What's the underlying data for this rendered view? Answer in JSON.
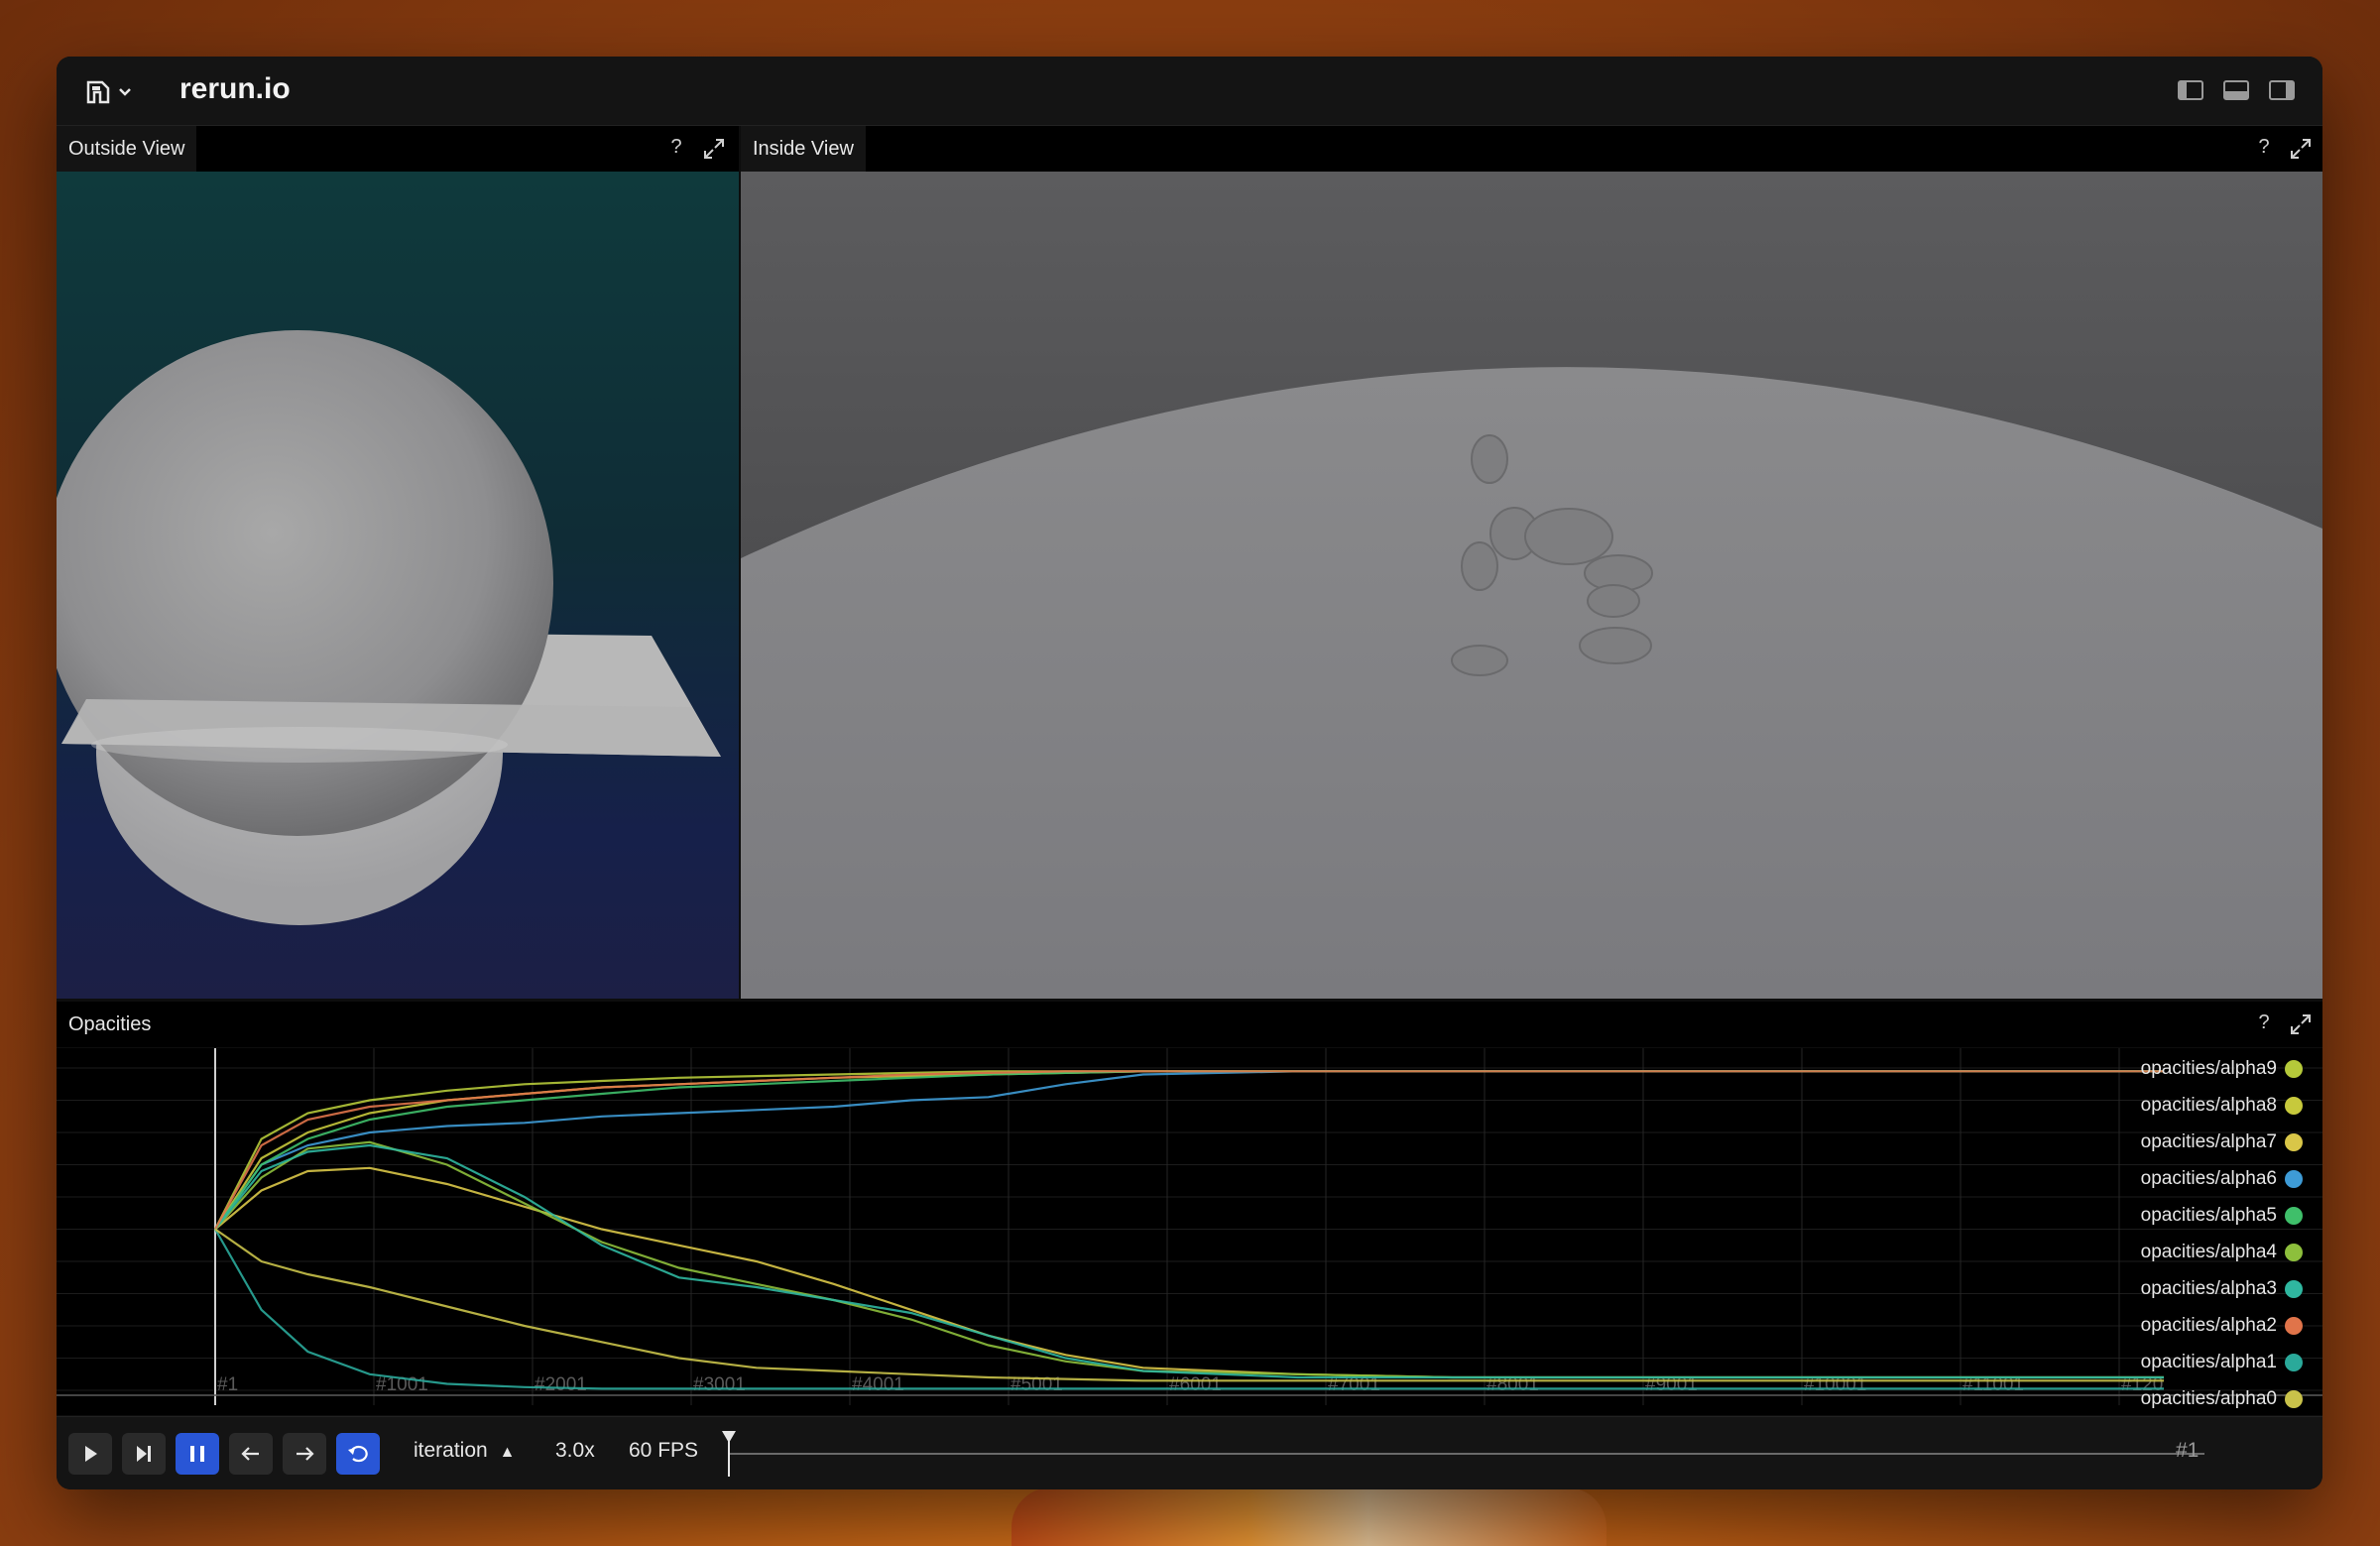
{
  "app": {
    "title": "rerun.io"
  },
  "panels": {
    "outside": {
      "title": "Outside View",
      "help": "?"
    },
    "inside": {
      "title": "Inside View",
      "help": "?"
    },
    "opacities": {
      "title": "Opacities",
      "help": "?"
    }
  },
  "timeline": {
    "timeline_name": "iteration",
    "speed": "3.0x",
    "fps": "60 FPS",
    "current": "#1",
    "accent_color": "#2956d6"
  },
  "chart_data": {
    "type": "line",
    "x_tick_labels": [
      "#1",
      "#1001",
      "#2001",
      "#3001",
      "#4001",
      "#5001",
      "#6001",
      "#7001",
      "#8001",
      "#9001",
      "#10001",
      "#11001",
      "#120"
    ],
    "xlim": [
      1,
      12600
    ],
    "ylim": [
      0,
      1
    ],
    "grid": true,
    "legend_placement": "right",
    "x": [
      1,
      300,
      600,
      1000,
      1500,
      2000,
      2500,
      3000,
      3500,
      4000,
      4500,
      5000,
      5500,
      6000,
      7000,
      8000,
      9000,
      10000,
      12600
    ],
    "series": [
      {
        "name": "opacities/alpha9",
        "color": "#b5c93a",
        "values": [
          0.5,
          0.78,
          0.86,
          0.9,
          0.93,
          0.95,
          0.96,
          0.97,
          0.975,
          0.98,
          0.985,
          0.99,
          0.99,
          0.99,
          0.99,
          0.99,
          0.99,
          0.99,
          0.99
        ]
      },
      {
        "name": "opacities/alpha8",
        "color": "#c7c93c",
        "values": [
          0.5,
          0.72,
          0.8,
          0.86,
          0.9,
          0.92,
          0.94,
          0.95,
          0.96,
          0.97,
          0.975,
          0.98,
          0.985,
          0.99,
          0.99,
          0.99,
          0.99,
          0.99,
          0.99
        ]
      },
      {
        "name": "opacities/alpha7",
        "color": "#d9c648",
        "values": [
          0.5,
          0.62,
          0.68,
          0.69,
          0.64,
          0.57,
          0.5,
          0.45,
          0.4,
          0.33,
          0.25,
          0.17,
          0.11,
          0.07,
          0.05,
          0.04,
          0.04,
          0.04,
          0.04
        ]
      },
      {
        "name": "opacities/alpha6",
        "color": "#3e9bd6",
        "values": [
          0.5,
          0.7,
          0.76,
          0.8,
          0.82,
          0.83,
          0.85,
          0.86,
          0.87,
          0.88,
          0.9,
          0.91,
          0.95,
          0.98,
          0.99,
          0.99,
          0.99,
          0.99,
          0.99
        ]
      },
      {
        "name": "opacities/alpha5",
        "color": "#3fbf6a",
        "values": [
          0.5,
          0.7,
          0.78,
          0.84,
          0.88,
          0.9,
          0.92,
          0.94,
          0.95,
          0.96,
          0.97,
          0.98,
          0.985,
          0.99,
          0.99,
          0.99,
          0.99,
          0.99,
          0.99
        ]
      },
      {
        "name": "opacities/alpha4",
        "color": "#8dbf3c",
        "values": [
          0.5,
          0.66,
          0.75,
          0.77,
          0.7,
          0.58,
          0.46,
          0.38,
          0.33,
          0.28,
          0.22,
          0.14,
          0.09,
          0.06,
          0.05,
          0.04,
          0.04,
          0.04,
          0.04
        ]
      },
      {
        "name": "opacities/alpha3",
        "color": "#2fb7a0",
        "values": [
          0.5,
          0.68,
          0.74,
          0.76,
          0.72,
          0.6,
          0.45,
          0.35,
          0.32,
          0.28,
          0.24,
          0.17,
          0.1,
          0.06,
          0.04,
          0.04,
          0.04,
          0.04,
          0.04
        ]
      },
      {
        "name": "opacities/alpha2",
        "color": "#e0744a",
        "values": [
          0.5,
          0.76,
          0.84,
          0.88,
          0.9,
          0.92,
          0.94,
          0.95,
          0.96,
          0.97,
          0.98,
          0.985,
          0.99,
          0.99,
          0.99,
          0.99,
          0.99,
          0.99,
          0.99
        ]
      },
      {
        "name": "opacities/alpha1",
        "color": "#2aa99a",
        "values": [
          0.5,
          0.25,
          0.12,
          0.05,
          0.02,
          0.01,
          0.005,
          0.005,
          0.005,
          0.005,
          0.005,
          0.005,
          0.005,
          0.005,
          0.005,
          0.005,
          0.005,
          0.005,
          0.005
        ]
      },
      {
        "name": "opacities/alpha0",
        "color": "#c9c24a",
        "values": [
          0.5,
          0.4,
          0.36,
          0.32,
          0.26,
          0.2,
          0.15,
          0.1,
          0.07,
          0.06,
          0.05,
          0.04,
          0.035,
          0.03,
          0.03,
          0.03,
          0.03,
          0.03,
          0.03
        ]
      }
    ]
  }
}
